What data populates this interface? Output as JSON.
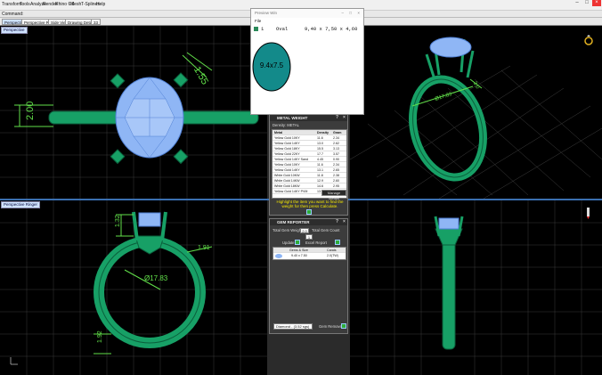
{
  "menubar": {
    "items": [
      "Transform",
      "Tools",
      "Analyze",
      "Render",
      "Rhino 6.6",
      "Mesh",
      "T-Splines",
      "Help"
    ],
    "controls": [
      "–",
      "□",
      "×"
    ]
  },
  "command": {
    "label": "Command:"
  },
  "tabs": [
    "Perspective",
    "Perspective Ringer",
    "Side View",
    "Drawing Detail",
    "33"
  ],
  "viewports": {
    "top_left": {
      "dims": {
        "top": "1.55",
        "side": "2.00"
      }
    },
    "top_right": {
      "dims": {
        "diameter": "Ø17.83",
        "height": "3.0"
      }
    },
    "bottom_left": {
      "label": "Perspective Ringer",
      "dims": {
        "top": "1.32",
        "right": "1.91",
        "inner": "Ø17.83",
        "bottom": "1.92"
      }
    },
    "bottom_right": {}
  },
  "preview": {
    "title": "Preview Win",
    "controls": [
      "–",
      "□",
      "×"
    ],
    "menu": "File",
    "row": {
      "index": "1",
      "shape": "Oval",
      "size": "9,40 x 7,50 x 4,60"
    },
    "gem_label": "9.4x7.5"
  },
  "metal_weight": {
    "title": "METAL WEIGHT",
    "metal_label": "Density: METAL",
    "columns": [
      "Metal",
      "Density",
      "Gram"
    ],
    "rows": [
      {
        "metal": "Yellow Gold 10KY",
        "density": "11.6",
        "gram": "2.34"
      },
      {
        "metal": "Yellow Gold 14KY",
        "density": "13.0",
        "gram": "2.62"
      },
      {
        "metal": "Yellow Gold 18KY",
        "density": "15.5",
        "gram": "3.13"
      },
      {
        "metal": "Yellow Gold 22KY",
        "density": "17.7",
        "gram": "3.57"
      },
      {
        "metal": "Yellow Gold 14KY Sand",
        "density": "4.45",
        "gram": "0.90"
      },
      {
        "metal": "Yellow Gold 10KY",
        "density": "11.6",
        "gram": "2.34"
      },
      {
        "metal": "Yellow Gold 14KY",
        "density": "13.1",
        "gram": "2.65"
      },
      {
        "metal": "White Gold 10KW",
        "density": "11.8",
        "gram": "2.38"
      },
      {
        "metal": "White Gold 14KW",
        "density": "12.9",
        "gram": "2.60"
      },
      {
        "metal": "White Gold 18KW",
        "density": "14.6",
        "gram": "2.95"
      },
      {
        "metal": "Yellow Gold 14KY PVM",
        "density": "13.4",
        "gram": "2.71"
      }
    ],
    "button": "Manage Metals",
    "hint": "Highlight the item you want to find the weight for then press Calculate."
  },
  "gem_reporter": {
    "title": "GEM REPORTER",
    "total_weight_label": "Total Gem Weight",
    "total_weight": "2.0",
    "total_count_label": "Total Gem Count",
    "total_count": "1",
    "update_label": "Update",
    "export_label": "Excel Report",
    "columns": [
      "",
      "Gems & Size",
      "Carats"
    ],
    "row": {
      "size": "9.40 x 7.50",
      "carat": "2.0(TW)"
    },
    "material": "Diamond - (3.52 sgs)",
    "gem_remover_label": "Gem Remover"
  },
  "colors": {
    "gem": "#8fb6f5",
    "gem_dark": "#4f7fd4",
    "metal": "#17a066",
    "metal_dark": "#0b5f3c",
    "dimension": "#62e04a",
    "preview_gem": "#138a8a"
  },
  "icons": [
    "ring-icon",
    "pen-icon"
  ]
}
